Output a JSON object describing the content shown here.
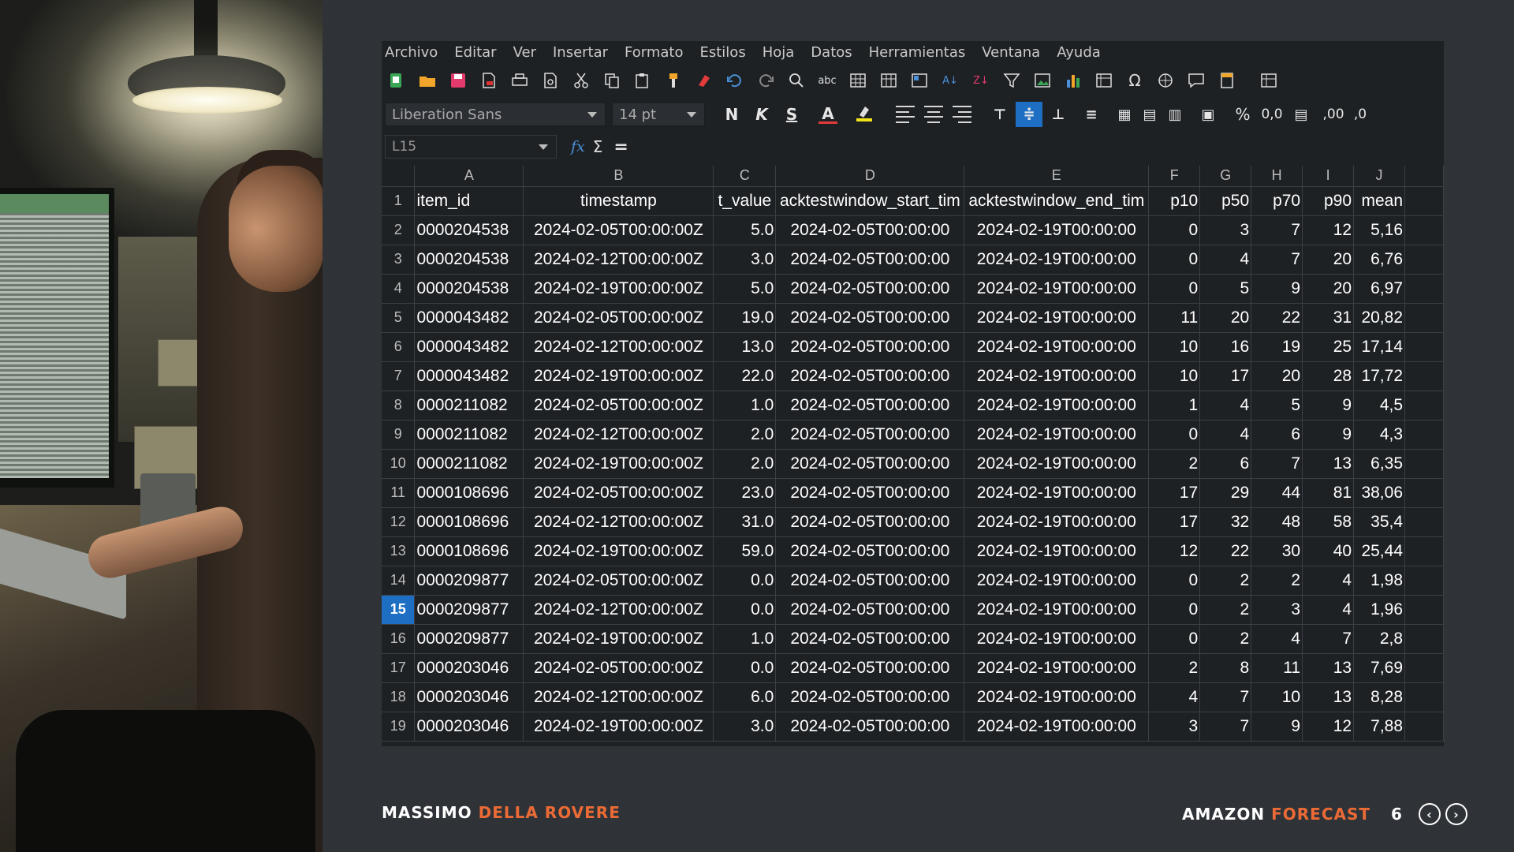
{
  "menu": [
    "Archivo",
    "Editar",
    "Ver",
    "Insertar",
    "Formato",
    "Estilos",
    "Hoja",
    "Datos",
    "Herramientas",
    "Ventana",
    "Ayuda"
  ],
  "format_bar": {
    "font_name": "Liberation Sans",
    "font_size": "14 pt",
    "bold_label": "N",
    "italic_label": "K",
    "underline_label": "S",
    "font_color_label": "A",
    "percent_label": "%",
    "decimal_label": "0,0",
    "add_decimal_label": ",00",
    "remove_decimal_label": ",0"
  },
  "formula_bar": {
    "cell_ref": "L15",
    "fx": "fx",
    "sigma": "Σ",
    "equals": "="
  },
  "columns": [
    "A",
    "B",
    "C",
    "D",
    "E",
    "F",
    "G",
    "H",
    "I",
    "J",
    ""
  ],
  "selected_row": 15,
  "header_row": {
    "row_num": "1",
    "cells": [
      "item_id",
      "timestamp",
      "t_value",
      "acktestwindow_start_tim",
      "acktestwindow_end_tim",
      "p10",
      "p50",
      "p70",
      "p90",
      "mean"
    ]
  },
  "rows": [
    {
      "n": "2",
      "c": [
        "0000204538",
        "2024-02-05T00:00:00Z",
        "5.0",
        "2024-02-05T00:00:00",
        "2024-02-19T00:00:00",
        "0",
        "3",
        "7",
        "12",
        "5,16"
      ]
    },
    {
      "n": "3",
      "c": [
        "0000204538",
        "2024-02-12T00:00:00Z",
        "3.0",
        "2024-02-05T00:00:00",
        "2024-02-19T00:00:00",
        "0",
        "4",
        "7",
        "20",
        "6,76"
      ]
    },
    {
      "n": "4",
      "c": [
        "0000204538",
        "2024-02-19T00:00:00Z",
        "5.0",
        "2024-02-05T00:00:00",
        "2024-02-19T00:00:00",
        "0",
        "5",
        "9",
        "20",
        "6,97"
      ]
    },
    {
      "n": "5",
      "c": [
        "0000043482",
        "2024-02-05T00:00:00Z",
        "19.0",
        "2024-02-05T00:00:00",
        "2024-02-19T00:00:00",
        "11",
        "20",
        "22",
        "31",
        "20,82"
      ]
    },
    {
      "n": "6",
      "c": [
        "0000043482",
        "2024-02-12T00:00:00Z",
        "13.0",
        "2024-02-05T00:00:00",
        "2024-02-19T00:00:00",
        "10",
        "16",
        "19",
        "25",
        "17,14"
      ]
    },
    {
      "n": "7",
      "c": [
        "0000043482",
        "2024-02-19T00:00:00Z",
        "22.0",
        "2024-02-05T00:00:00",
        "2024-02-19T00:00:00",
        "10",
        "17",
        "20",
        "28",
        "17,72"
      ]
    },
    {
      "n": "8",
      "c": [
        "0000211082",
        "2024-02-05T00:00:00Z",
        "1.0",
        "2024-02-05T00:00:00",
        "2024-02-19T00:00:00",
        "1",
        "4",
        "5",
        "9",
        "4,5"
      ]
    },
    {
      "n": "9",
      "c": [
        "0000211082",
        "2024-02-12T00:00:00Z",
        "2.0",
        "2024-02-05T00:00:00",
        "2024-02-19T00:00:00",
        "0",
        "4",
        "6",
        "9",
        "4,3"
      ]
    },
    {
      "n": "10",
      "c": [
        "0000211082",
        "2024-02-19T00:00:00Z",
        "2.0",
        "2024-02-05T00:00:00",
        "2024-02-19T00:00:00",
        "2",
        "6",
        "7",
        "13",
        "6,35"
      ]
    },
    {
      "n": "11",
      "c": [
        "0000108696",
        "2024-02-05T00:00:00Z",
        "23.0",
        "2024-02-05T00:00:00",
        "2024-02-19T00:00:00",
        "17",
        "29",
        "44",
        "81",
        "38,06"
      ]
    },
    {
      "n": "12",
      "c": [
        "0000108696",
        "2024-02-12T00:00:00Z",
        "31.0",
        "2024-02-05T00:00:00",
        "2024-02-19T00:00:00",
        "17",
        "32",
        "48",
        "58",
        "35,4"
      ]
    },
    {
      "n": "13",
      "c": [
        "0000108696",
        "2024-02-19T00:00:00Z",
        "59.0",
        "2024-02-05T00:00:00",
        "2024-02-19T00:00:00",
        "12",
        "22",
        "30",
        "40",
        "25,44"
      ]
    },
    {
      "n": "14",
      "c": [
        "0000209877",
        "2024-02-05T00:00:00Z",
        "0.0",
        "2024-02-05T00:00:00",
        "2024-02-19T00:00:00",
        "0",
        "2",
        "2",
        "4",
        "1,98"
      ]
    },
    {
      "n": "15",
      "c": [
        "0000209877",
        "2024-02-12T00:00:00Z",
        "0.0",
        "2024-02-05T00:00:00",
        "2024-02-19T00:00:00",
        "0",
        "2",
        "3",
        "4",
        "1,96"
      ]
    },
    {
      "n": "16",
      "c": [
        "0000209877",
        "2024-02-19T00:00:00Z",
        "1.0",
        "2024-02-05T00:00:00",
        "2024-02-19T00:00:00",
        "0",
        "2",
        "4",
        "7",
        "2,8"
      ]
    },
    {
      "n": "17",
      "c": [
        "0000203046",
        "2024-02-05T00:00:00Z",
        "0.0",
        "2024-02-05T00:00:00",
        "2024-02-19T00:00:00",
        "2",
        "8",
        "11",
        "13",
        "7,69"
      ]
    },
    {
      "n": "18",
      "c": [
        "0000203046",
        "2024-02-12T00:00:00Z",
        "6.0",
        "2024-02-05T00:00:00",
        "2024-02-19T00:00:00",
        "4",
        "7",
        "10",
        "13",
        "8,28"
      ]
    },
    {
      "n": "19",
      "c": [
        "0000203046",
        "2024-02-19T00:00:00Z",
        "3.0",
        "2024-02-05T00:00:00",
        "2024-02-19T00:00:00",
        "3",
        "7",
        "9",
        "12",
        "7,88"
      ]
    }
  ],
  "footer": {
    "author_first": "MASSIMO",
    "author_last": "DELLA ROVERE",
    "topic_first": "AMAZON",
    "topic_second": "FORECAST",
    "page": "6",
    "prev": "‹",
    "next": "›"
  },
  "colors": {
    "accent": "#ec6a35",
    "selection": "#1e6fc4",
    "background": "#2f3337",
    "sheet_bg": "#1e2124"
  },
  "icons": [
    "new-document-icon",
    "open-folder-icon",
    "save-icon",
    "export-pdf-icon",
    "print-icon",
    "print-preview-icon",
    "cut-icon",
    "copy-icon",
    "paste-icon",
    "clone-format-icon",
    "clear-format-icon",
    "undo-icon",
    "redo-icon",
    "find-replace-icon",
    "spellcheck-icon",
    "row-icon",
    "column-icon",
    "freeze-icon",
    "sort-ascending-icon",
    "sort-descending-icon",
    "autofilter-icon",
    "insert-image-icon",
    "insert-chart-icon",
    "pivot-table-icon",
    "special-character-icon",
    "hyperlink-icon",
    "comment-icon",
    "header-footer-icon",
    "define-print-area-icon"
  ]
}
